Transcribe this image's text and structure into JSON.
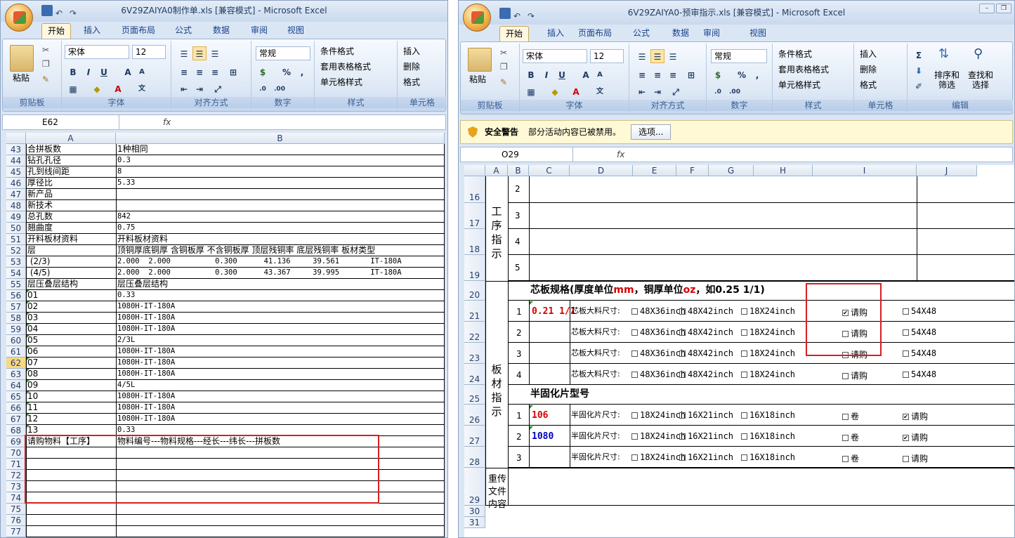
{
  "left": {
    "title": "6V29ZAIYA0制作单.xls  [兼容模式] - Microsoft Excel",
    "tabs": [
      "开始",
      "插入",
      "页面布局",
      "公式",
      "数据",
      "审阅",
      "视图"
    ],
    "font_name": "宋体",
    "font_size": "12",
    "number_format": "常规",
    "groups": {
      "clipboard": "剪贴板",
      "font": "字体",
      "align": "对齐方式",
      "number": "数字",
      "styles": "样式",
      "cells": "单元格"
    },
    "styles": [
      "条件格式",
      "套用表格格式",
      "单元格样式"
    ],
    "cells": [
      "插入",
      "删除",
      "格式"
    ],
    "paste": "粘贴",
    "name_box": "E62",
    "fx": "fx",
    "col_headers": [
      "A",
      "B"
    ],
    "rows": [
      {
        "n": "43",
        "a": "合拼板数",
        "b": "1种相同"
      },
      {
        "n": "44",
        "a": "钻孔孔径",
        "b": "0.3"
      },
      {
        "n": "45",
        "a": "孔到线间距",
        "b": "8"
      },
      {
        "n": "46",
        "a": "厚径比",
        "b": "5.33"
      },
      {
        "n": "47",
        "a": "新产品",
        "b": ""
      },
      {
        "n": "48",
        "a": "新技术",
        "b": ""
      },
      {
        "n": "49",
        "a": "总孔数",
        "b": "842"
      },
      {
        "n": "50",
        "a": "翘曲度",
        "b": "0.75"
      },
      {
        "n": "51",
        "a": "开料板材资料",
        "b": "开料板材资料"
      },
      {
        "n": "52",
        "a": "层",
        "b": "顶铜厚底铜厚 含铜板厚 不含铜板厚 顶层残铜率 底层残铜率 板材类型"
      },
      {
        "n": "53",
        "a": " (2/3)",
        "b": "2.000  2.000          0.300      41.136     39.561       IT-180A"
      },
      {
        "n": "54",
        "a": " (4/5)",
        "b": "2.000  2.000          0.300      43.367     39.995       IT-180A"
      },
      {
        "n": "55",
        "a": "层压叠层结构",
        "b": "层压叠层结构"
      },
      {
        "n": "56",
        "a": "01",
        "b": "0.33"
      },
      {
        "n": "57",
        "a": "02",
        "b": "1080H-IT-180A"
      },
      {
        "n": "58",
        "a": "03",
        "b": "1080H-IT-180A"
      },
      {
        "n": "59",
        "a": "04",
        "b": "1080H-IT-180A"
      },
      {
        "n": "60",
        "a": "05",
        "b": "2/3L"
      },
      {
        "n": "61",
        "a": "06",
        "b": "1080H-IT-180A"
      },
      {
        "n": "62",
        "a": "07",
        "b": "1080H-IT-180A"
      },
      {
        "n": "63",
        "a": "08",
        "b": "1080H-IT-180A"
      },
      {
        "n": "64",
        "a": "09",
        "b": "4/5L"
      },
      {
        "n": "65",
        "a": "10",
        "b": "1080H-IT-180A"
      },
      {
        "n": "66",
        "a": "11",
        "b": "1080H-IT-180A"
      },
      {
        "n": "67",
        "a": "12",
        "b": "1080H-IT-180A"
      },
      {
        "n": "68",
        "a": "13",
        "b": "0.33"
      },
      {
        "n": "69",
        "a": "请购物料【工序】",
        "b": "物料编号---物料规格---经长---纬长---拼板数"
      },
      {
        "n": "70",
        "a": "",
        "b": ""
      },
      {
        "n": "71",
        "a": "",
        "b": ""
      },
      {
        "n": "72",
        "a": "",
        "b": ""
      },
      {
        "n": "73",
        "a": "",
        "b": ""
      },
      {
        "n": "74",
        "a": "",
        "b": ""
      },
      {
        "n": "75",
        "a": "",
        "b": ""
      },
      {
        "n": "76",
        "a": "",
        "b": ""
      },
      {
        "n": "77",
        "a": "",
        "b": ""
      }
    ]
  },
  "right": {
    "title": "6V29ZAIYA0-预审指示.xls  [兼容模式] - Microsoft Excel",
    "tabs": [
      "开始",
      "插入",
      "页面布局",
      "公式",
      "数据",
      "审阅",
      "视图"
    ],
    "font_name": "宋体",
    "font_size": "12",
    "number_format": "常规",
    "groups": {
      "clipboard": "剪贴板",
      "font": "字体",
      "align": "对齐方式",
      "number": "数字",
      "styles": "样式",
      "cells": "单元格",
      "edit": "编辑"
    },
    "styles": [
      "条件格式",
      "套用表格格式",
      "单元格样式"
    ],
    "cells": [
      "插入",
      "删除",
      "格式"
    ],
    "sort": "排序和筛选",
    "find": "查找和选择",
    "paste": "粘贴",
    "security_title": "安全警告",
    "security_msg": "部分活动内容已被禁用。",
    "security_btn": "选项...",
    "name_box": "O29",
    "fx": "fx",
    "col_headers": [
      "A",
      "B",
      "C",
      "D",
      "E",
      "F",
      "G",
      "H",
      "I",
      "J"
    ],
    "row_numbers": [
      "16",
      "17",
      "18",
      "19",
      "20",
      "21",
      "22",
      "23",
      "24",
      "25",
      "26",
      "27",
      "28",
      "29",
      "30",
      "31"
    ],
    "process_label": "工序指示",
    "process_steps": [
      "2",
      "3",
      "4",
      "5"
    ],
    "board_label": "板材指示",
    "core_title": "芯板规格(厚度单位mm，铜厚单位oz，如0.25 1/1)",
    "core_title_parts": [
      "芯板规格(厚度单位",
      "mm",
      "，铜厚单位",
      "oz",
      "，如0.25 1/1)"
    ],
    "core_rows": [
      {
        "no": "1",
        "spec": "0.21 1/1",
        "label": "芯板大料尺寸:",
        "opts": [
          "48X36inch",
          "48X42inch",
          "18X24inch",
          "请购",
          "54X48"
        ],
        "checked": [
          false,
          false,
          false,
          true,
          false
        ]
      },
      {
        "no": "2",
        "spec": "",
        "label": "芯板大料尺寸:",
        "opts": [
          "48X36inch",
          "48X42inch",
          "18X24inch",
          "请购",
          "54X48"
        ],
        "checked": [
          false,
          false,
          false,
          false,
          false
        ]
      },
      {
        "no": "3",
        "spec": "",
        "label": "芯板大料尺寸:",
        "opts": [
          "48X36inch",
          "48X42inch",
          "18X24inch",
          "请购",
          "54X48"
        ],
        "checked": [
          false,
          false,
          false,
          false,
          false
        ]
      },
      {
        "no": "4",
        "spec": "",
        "label": "芯板大料尺寸:",
        "opts": [
          "48X36inch",
          "48X42inch",
          "18X24inch",
          "请购",
          "54X48"
        ],
        "checked": [
          false,
          false,
          false,
          false,
          false
        ]
      }
    ],
    "prepreg_title": "半固化片型号",
    "prepreg_rows": [
      {
        "no": "1",
        "spec": "106",
        "label": "半固化片尺寸:",
        "opts": [
          "18X24inch",
          "16X21inch",
          "16X18inch",
          "卷",
          "请购"
        ],
        "checked": [
          false,
          false,
          false,
          false,
          true
        ]
      },
      {
        "no": "2",
        "spec": "1080",
        "label": "半固化片尺寸:",
        "opts": [
          "18X24inch",
          "16X21inch",
          "16X18inch",
          "卷",
          "请购"
        ],
        "checked": [
          false,
          false,
          false,
          false,
          true
        ]
      },
      {
        "no": "3",
        "spec": "",
        "label": "半固化片尺寸:",
        "opts": [
          "18X24inch",
          "16X21inch",
          "16X18inch",
          "卷",
          "请购"
        ],
        "checked": [
          false,
          false,
          false,
          false,
          false
        ]
      }
    ],
    "reupload_label": "重传文件内容",
    "colors": {
      "red": "#d40000",
      "blue": "#0000c0",
      "green_cell": "#d7f5c6",
      "highlight": "#d62020"
    }
  }
}
